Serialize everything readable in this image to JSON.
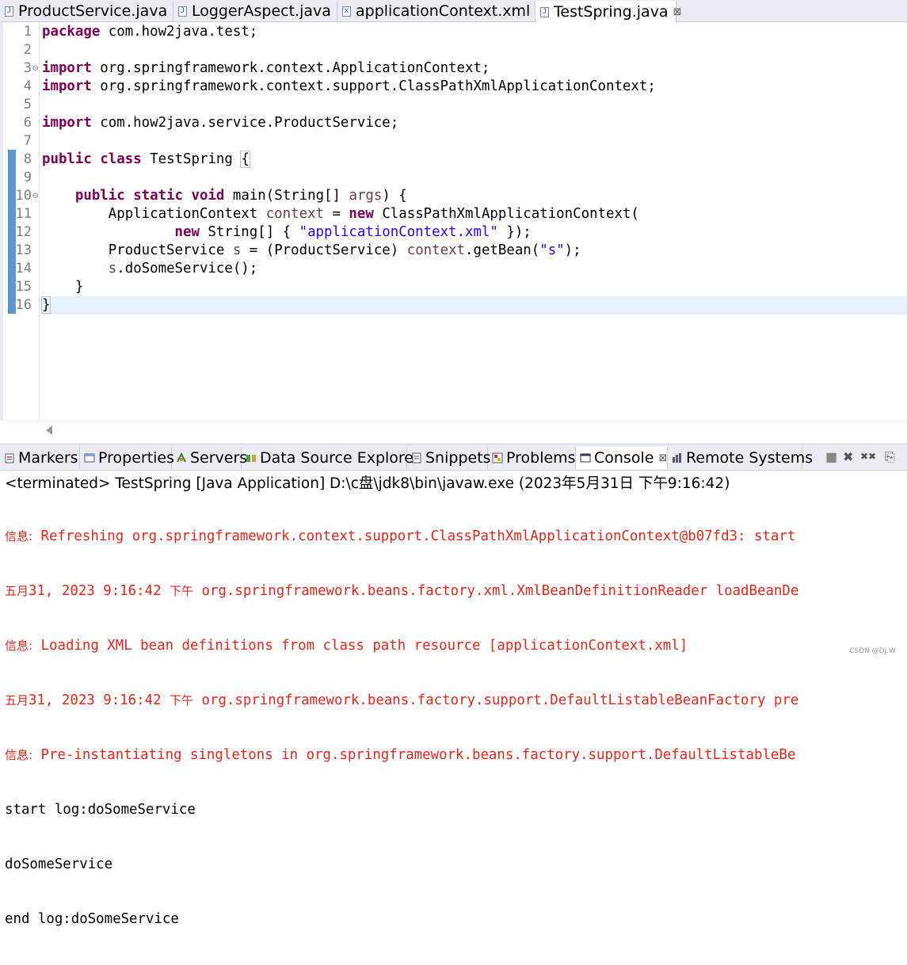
{
  "editor_tabs": [
    {
      "label": "ProductService.java",
      "icon": "java-file-icon",
      "active": false
    },
    {
      "label": "LoggerAspect.java",
      "icon": "java-file-icon",
      "active": false
    },
    {
      "label": "applicationContext.xml",
      "icon": "xml-file-icon",
      "active": false
    },
    {
      "label": "TestSpring.java",
      "icon": "java-file-icon",
      "active": true,
      "close": "⊠"
    }
  ],
  "editor": {
    "line_numbers": [
      "1",
      "2",
      "3",
      "4",
      "5",
      "6",
      "7",
      "8",
      "9",
      "10",
      "11",
      "12",
      "13",
      "14",
      "15",
      "16"
    ],
    "fold_markers": {
      "3": "⊖",
      "10": "⊖"
    },
    "current_line": 16,
    "code": {
      "l1_kw": "package",
      "l1_rest": " com.how2java.test;",
      "l3_kw": "import",
      "l3_rest": " org.springframework.context.ApplicationContext;",
      "l4_kw": "import",
      "l4_rest": " org.springframework.context.support.ClassPathXmlApplicationContext;",
      "l6_kw": "import",
      "l6_rest": " com.how2java.service.ProductService;",
      "l8_kw1": "public",
      "l8_kw2": "class",
      "l8_name": " TestSpring ",
      "l8_brace": "{",
      "l10_kw1": "public",
      "l10_kw2": "static",
      "l10_kw3": "void",
      "l10_sig1": " main(String[] ",
      "l10_args": "args",
      "l10_sig2": ") {",
      "l11_a": "ApplicationContext ",
      "l11_var": "context",
      "l11_b": " = ",
      "l11_kw": "new",
      "l11_c": " ClassPathXmlApplicationContext(",
      "l12_kw": "new",
      "l12_a": " String[] { ",
      "l12_str": "\"applicationContext.xml\"",
      "l12_b": " });",
      "l13_a": "ProductService ",
      "l13_var": "s",
      "l13_b": " = (ProductService) ",
      "l13_var2": "context",
      "l13_c": ".getBean(",
      "l13_str": "\"s\"",
      "l13_d": ");",
      "l14_var": "s",
      "l14_rest": ".doSomeService();",
      "l15": "}",
      "l16": "}"
    }
  },
  "views_tabs": [
    {
      "label": "Markers",
      "icon": "markers-icon",
      "active": false
    },
    {
      "label": "Properties",
      "icon": "properties-icon",
      "active": false
    },
    {
      "label": "Servers",
      "icon": "servers-icon",
      "active": false
    },
    {
      "label": "Data Source Explorer",
      "icon": "database-icon",
      "active": false
    },
    {
      "label": "Snippets",
      "icon": "snippets-icon",
      "active": false
    },
    {
      "label": "Problems",
      "icon": "problems-icon",
      "active": false
    },
    {
      "label": "Console",
      "icon": "console-icon",
      "active": true,
      "close": "⊠"
    },
    {
      "label": "Remote Systems",
      "icon": "remote-systems-icon",
      "active": false
    }
  ],
  "view_toolbar": {
    "terminate": "■",
    "remove": "✖",
    "remove_all": "✖✖",
    "pin": "⎘"
  },
  "console": {
    "header": "<terminated> TestSpring [Java Application] D:\\c盘\\jdk8\\bin\\javaw.exe (2023年5月31日 下午9:16:42)",
    "lines": [
      {
        "type": "err",
        "cjk": "信息:",
        "text": " Refreshing org.springframework.context.support.ClassPathXmlApplicationContext@b07fd3: start"
      },
      {
        "type": "err",
        "cjk": "五月",
        "text": "31, 2023 9:16:42 ",
        "cjk2": "下午",
        "text2": " org.springframework.beans.factory.xml.XmlBeanDefinitionReader loadBeanDe"
      },
      {
        "type": "err",
        "cjk": "信息:",
        "text": " Loading XML bean definitions from class path resource [applicationContext.xml]"
      },
      {
        "type": "err",
        "cjk": "五月",
        "text": "31, 2023 9:16:42 ",
        "cjk2": "下午",
        "text2": " org.springframework.beans.factory.support.DefaultListableBeanFactory pre"
      },
      {
        "type": "err",
        "cjk": "信息:",
        "text": " Pre-instantiating singletons in org.springframework.beans.factory.support.DefaultListableBe"
      },
      {
        "type": "out",
        "text": "start log:doSomeService"
      },
      {
        "type": "out",
        "text": "doSomeService"
      },
      {
        "type": "out",
        "text": "end log:doSomeService"
      }
    ]
  },
  "watermark": "CSDN @DJ.W",
  "colors": {
    "keyword": "#7f0055",
    "string": "#2a00ff",
    "variable": "#6a3e3e",
    "stderr": "#e8261a",
    "current_line": "#e8f2fe"
  }
}
